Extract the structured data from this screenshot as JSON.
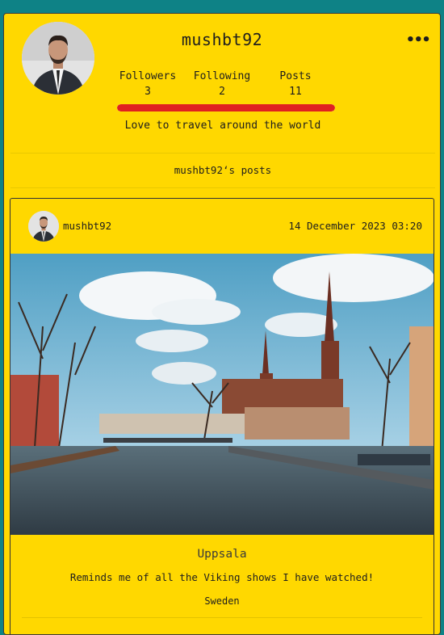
{
  "profile": {
    "username": "mushbt92",
    "more_icon": "•••",
    "stats": [
      {
        "label": "Followers",
        "value": "3"
      },
      {
        "label": "Following",
        "value": "2"
      },
      {
        "label": "Posts",
        "value": "11"
      }
    ],
    "bio": "Love to travel around the world"
  },
  "posts_section": {
    "title": "mushbt92‘s posts"
  },
  "post": {
    "username": "mushbt92",
    "date": "14 December 2023 03:20",
    "title": "Uppsala",
    "caption": "Reminds me of all the Viking shows I have watched!",
    "country": "Sweden"
  },
  "colors": {
    "background": "#0e8286",
    "card": "#ffd800",
    "progress": "#e02020"
  }
}
